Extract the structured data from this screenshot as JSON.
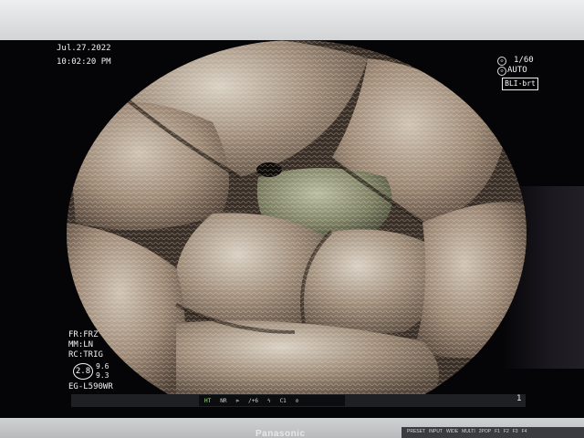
{
  "osd": {
    "date": "Jul.27.2022",
    "time": "10:02:20 PM",
    "shutter": "1/60",
    "iris": "AUTO",
    "mode_badge": "BLI-brt",
    "freeze": "FR:FRZ",
    "mm": "MM:LN",
    "rc": "RC:TRIG",
    "ring_value": "2.8",
    "value_a": "9.6",
    "value_b": "9.3",
    "scope_model": "EG-L590WR"
  },
  "status_bar": {
    "ht": "HT",
    "nr": "NR",
    "gain": "/+6",
    "c1": "C1",
    "counter": "1"
  },
  "monitor": {
    "brand": "Panasonic",
    "buttons": [
      "PRESET",
      "INPUT",
      "WIDE",
      "MULTI",
      "2POP",
      "F1",
      "F2",
      "F3",
      "F4"
    ]
  },
  "colors": {
    "tissue_base": "#8e7a66",
    "tissue_highlight": "#d8d0c4",
    "tissue_green": "#7d8066",
    "screen_black": "#050507"
  }
}
